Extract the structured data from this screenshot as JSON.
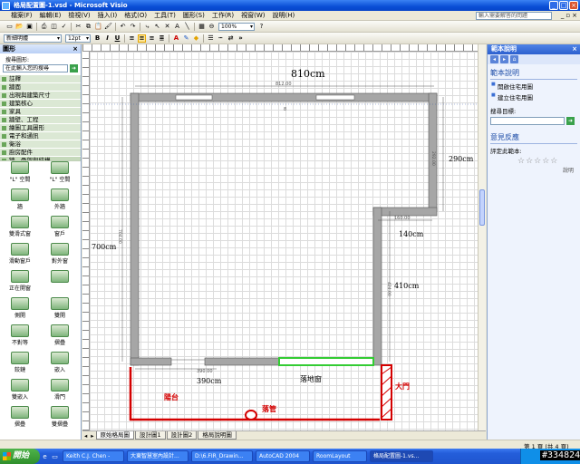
{
  "window": {
    "title": "格局配置圖-1.vsd - Microsoft Visio"
  },
  "menu": {
    "items": [
      "檔案(F)",
      "編輯(E)",
      "檢視(V)",
      "插入(I)",
      "格式(O)",
      "工具(T)",
      "圖形(S)",
      "工作(R)",
      "視窗(W)",
      "說明(H)"
    ],
    "help_placeholder": "輸入需要解答的問題"
  },
  "toolbar": {
    "zoom": "100%",
    "font": "新細明體",
    "font_size": "12pt"
  },
  "shapes_panel": {
    "title": "圖形",
    "search_label": "搜尋圖形:",
    "search_placeholder": "在此輸入您的搜尋",
    "stencils": [
      "註釋",
      "牆面",
      "出現與建築尺寸",
      "建築核心",
      "家具",
      "牆壁、工程",
      "繪圖工具圖形",
      "電子和通訊",
      "衛浴",
      "廚房配件",
      "牆、骨架與結構"
    ],
    "shapes": [
      {
        "label": "\"L\" 空間"
      },
      {
        "label": "\"L\" 空間"
      },
      {
        "label": "牆"
      },
      {
        "label": "外牆"
      },
      {
        "label": "雙滑式窗"
      },
      {
        "label": "窗戶"
      },
      {
        "label": "滑動窗戶"
      },
      {
        "label": "對外窗"
      },
      {
        "label": "正在開窗"
      },
      {
        "label": ""
      },
      {
        "label": "側開"
      },
      {
        "label": "雙開"
      },
      {
        "label": "不對等"
      },
      {
        "label": "摺疊"
      },
      {
        "label": "鉸鏈"
      },
      {
        "label": "嵌入"
      },
      {
        "label": "雙嵌入"
      },
      {
        "label": "滑門"
      },
      {
        "label": "摺疊"
      },
      {
        "label": "雙摺疊"
      }
    ]
  },
  "drawing": {
    "labels": {
      "top_width": "810cm",
      "top_dim": "812.00",
      "right_upper": "290cm",
      "right_upper_dim": "292.00",
      "notch_width": "140cm",
      "notch_dim": "160.00",
      "left_height": "700cm",
      "left_dim": "704.00",
      "right_lower": "410cm",
      "right_lower_dim": "424.00",
      "bottom_left": "390cm",
      "bottom_dim": "390.00",
      "window_label": "落地窗",
      "balcony": "陽台",
      "drain": "落管",
      "door": "大門",
      "misc_mark": "8"
    },
    "colors": {
      "wall": "#a6a6a6",
      "window": "#33cc33",
      "annotation": "#d40000"
    }
  },
  "page_tabs": [
    "原始格局圖",
    "設計圖1",
    "設計圖2",
    "格局說明圖"
  ],
  "task_pane": {
    "title": "範本說明",
    "section1_title": "範本說明",
    "links": [
      "開啟住宅用圖",
      "建立住宅用圖"
    ],
    "search_label": "搜尋目標:",
    "section2_title": "意見反應",
    "rating_label": "評定此範本:",
    "stars": "☆☆☆☆☆",
    "small_link": "說明"
  },
  "status": {
    "page_info": "第 1 頁 (共 4 頁)"
  },
  "taskbar": {
    "start": "開始",
    "items": [
      "Keith C.J. Chen -",
      "大東智慧室內設計...",
      "D:\\6.FIR_Drawin...",
      "AutoCAD 2004",
      "RoomLayout",
      "格局配置圖-1.vs..."
    ],
    "active_index": 5
  },
  "watermark": "#334824"
}
